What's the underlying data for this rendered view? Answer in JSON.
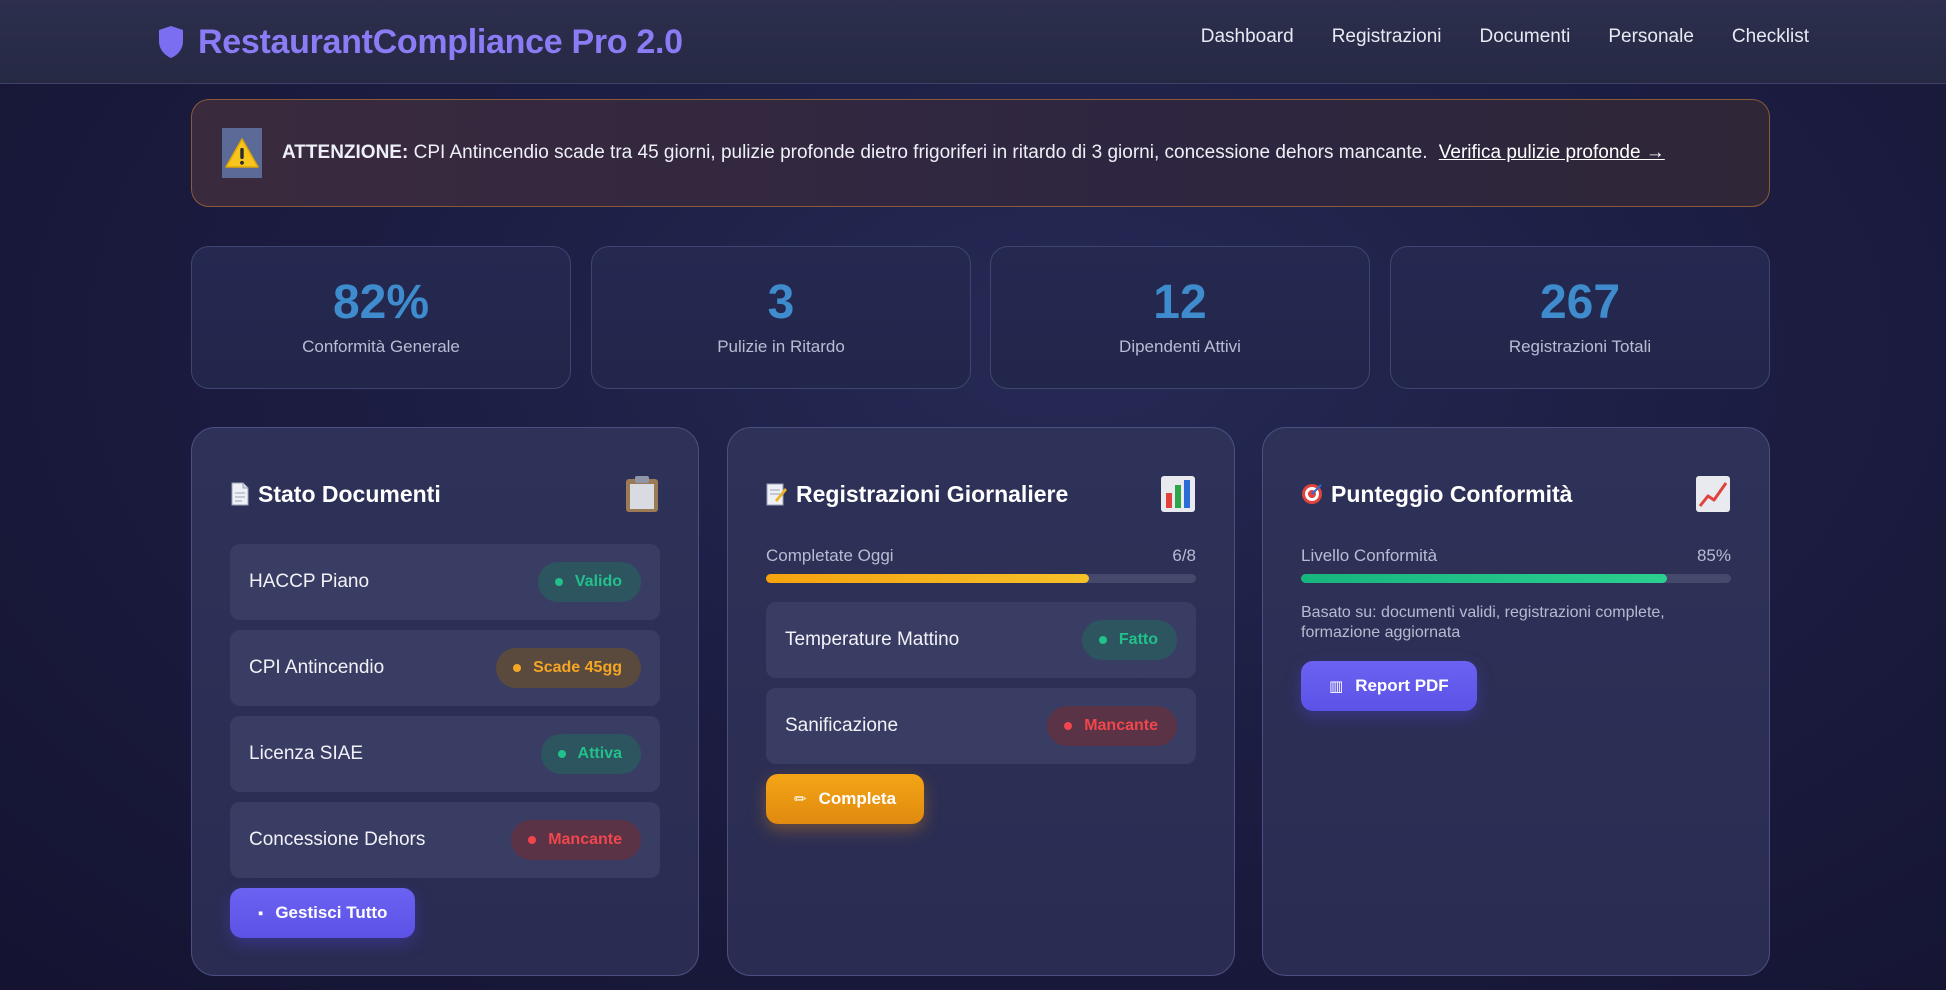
{
  "header": {
    "title": "RestaurantCompliance Pro 2.0",
    "nav": [
      "Dashboard",
      "Registrazioni",
      "Documenti",
      "Personale",
      "Checklist"
    ]
  },
  "alert": {
    "strong": "ATTENZIONE:",
    "text": "CPI Antincendio scade tra 45 giorni, pulizie profonde dietro frigoriferi in ritardo di 3 giorni, concessione dehors mancante.",
    "link": "Verifica pulizie profonde →",
    "icon": "warning-icon"
  },
  "stats": [
    {
      "value": "82%",
      "label": "Conformità Generale"
    },
    {
      "value": "3",
      "label": "Pulizie in Ritardo"
    },
    {
      "value": "12",
      "label": "Dipendenti Attivi"
    },
    {
      "value": "267",
      "label": "Registrazioni Totali"
    }
  ],
  "documents": {
    "title": "Stato Documenti",
    "icon": "clipboard-icon",
    "items": [
      {
        "label": "HACCP Piano",
        "status": "Valido",
        "tone": "green"
      },
      {
        "label": "CPI Antincendio",
        "status": "Scade 45gg",
        "tone": "orange"
      },
      {
        "label": "Licenza SIAE",
        "status": "Attiva",
        "tone": "green"
      },
      {
        "label": "Concessione Dehors",
        "status": "Mancante",
        "tone": "red"
      }
    ],
    "button": "Gestisci Tutto"
  },
  "daily": {
    "title": "Registrazioni Giornaliere",
    "icon": "bar-chart-icon",
    "progress_label": "Completate Oggi",
    "progress_value": "6/8",
    "progress_fraction": 0.75,
    "items": [
      {
        "label": "Temperature Mattino",
        "status": "Fatto",
        "tone": "green"
      },
      {
        "label": "Sanificazione",
        "status": "Mancante",
        "tone": "red"
      }
    ],
    "button": "Completa"
  },
  "score": {
    "title": "Punteggio Conformità",
    "icon": "trend-up-icon",
    "progress_label": "Livello Conformità",
    "progress_value": "85%",
    "progress_fraction": 0.85,
    "note": "Basato su: documenti validi, registrazioni complete, formazione aggiornata",
    "button": "Report PDF"
  },
  "colors": {
    "accent": "#8b7cf5",
    "stat_value": "#3e8ccd",
    "green": "#22c08a",
    "orange": "#f5a623",
    "red": "#f0464c"
  }
}
